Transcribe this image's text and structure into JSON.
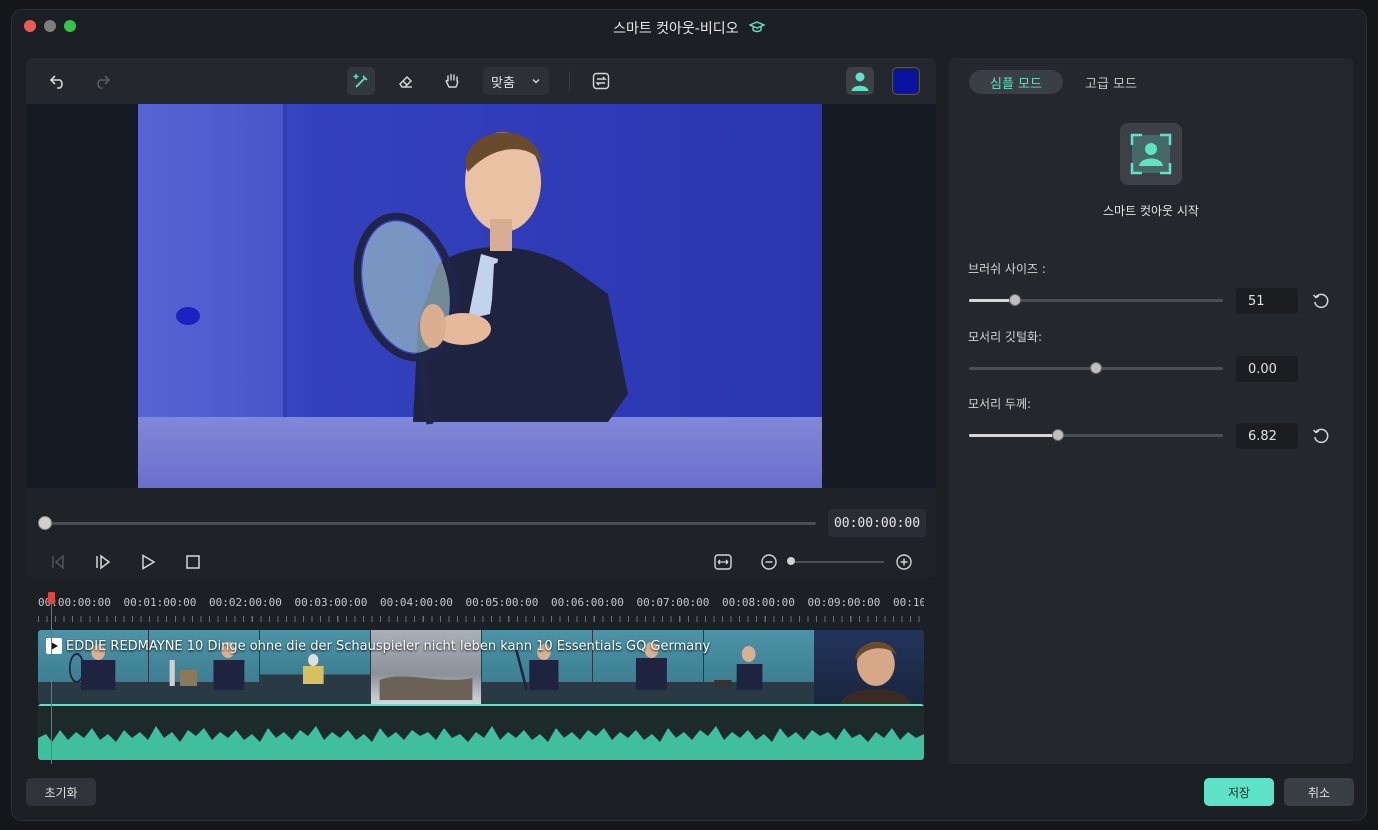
{
  "window": {
    "title": "스마트 컷아웃-비디오"
  },
  "toolbar": {
    "undo": "undo-icon",
    "redo": "redo-icon",
    "fit_select": "맞춤",
    "mask_color": "#0a12a0"
  },
  "player": {
    "timecode": "00:00:00:00",
    "progress": 0
  },
  "timeline": {
    "ruler": [
      "00:00:00:00",
      "00:01:00:00",
      "00:02:00:00",
      "00:03:00:00",
      "00:04:00:00",
      "00:05:00:00",
      "00:06:00:00",
      "00:07:00:00",
      "00:08:00:00",
      "00:09:00:00",
      "00:10"
    ],
    "clip_title": "EDDIE REDMAYNE 10 Dinge ohne die der Schauspieler nicht leben kann   10 Essentials   GQ Germany"
  },
  "panel": {
    "tab_simple": "심플 모드",
    "tab_advanced": "고급 모드",
    "start_label": "스마트 컷아웃 시작",
    "params": [
      {
        "label": "브러쉬 사이즈 :",
        "value": "51",
        "level": 0.18
      },
      {
        "label": "모서리 깃털화:",
        "value": "0.00",
        "level": 0.5
      },
      {
        "label": "모서리 두께:",
        "value": "6.82",
        "level": 0.35
      }
    ]
  },
  "footer": {
    "reset": "초기화",
    "save": "저장",
    "cancel": "취소"
  },
  "colors": {
    "accent": "#5fe3c7",
    "playhead": "#e0453f"
  }
}
